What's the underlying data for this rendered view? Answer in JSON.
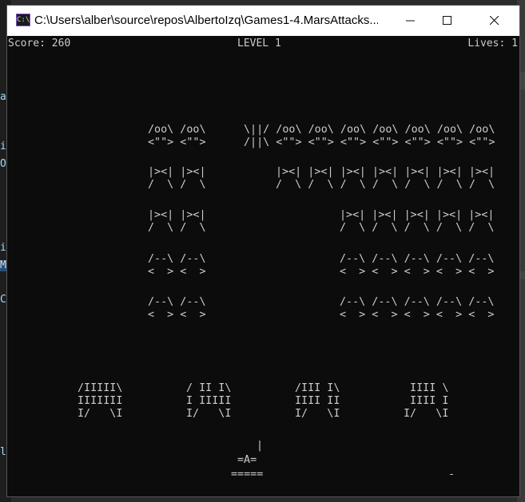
{
  "background_editor": {
    "fragments": [
      "a",
      "i",
      "O",
      "i",
      "M",
      "C",
      "l"
    ]
  },
  "window": {
    "icon_text": "C:\\",
    "title": "C:\\Users\\alber\\source\\repos\\AlbertoIzq\\Games1-4.MarsAttacks...",
    "buttons": {
      "minimize": "minimize",
      "maximize": "maximize",
      "close": "close"
    }
  },
  "hud": {
    "score": "Score: 260",
    "level": "LEVEL 1",
    "lives": "Lives: 1"
  },
  "aliens": {
    "row1_left": "/oo\\ /oo\\\n<\"\"> <\"\">",
    "row1_right": "\\||/ /oo\\ /oo\\ /oo\\ /oo\\ /oo\\ /oo\\ /oo\\\n/||\\ <\"\"> <\"\"> <\"\"> <\"\"> <\"\"> <\"\"> <\"\">",
    "row2_left": "|><| |><|\n/  \\ /  \\",
    "row2_right": "|><| |><| |><| |><| |><| |><| |><|\n/  \\ /  \\ /  \\ /  \\ /  \\ /  \\ /  \\",
    "row3_left": "|><| |><|\n/  \\ /  \\",
    "row3_right": "|><| |><| |><| |><| |><|\n/  \\ /  \\ /  \\ /  \\ /  \\",
    "row4_left": "/--\\ /--\\\n<  > <  >",
    "row4_right": "/--\\ /--\\ /--\\ /--\\ /--\\\n<  > <  > <  > <  > <  >",
    "row5_left": "/--\\ /--\\\n<  > <  >",
    "row5_right": "/--\\ /--\\ /--\\ /--\\ /--\\\n<  > <  > <  > <  > <  >"
  },
  "shields": [
    "/IIIII\\\nIIIIIII\nI/   \\I",
    "/ II I\\\nI IIIII\nI/   \\I",
    "/III I\\\nIIII II\nI/   \\I",
    " IIII \\\n IIII I\nI/   \\I"
  ],
  "player": {
    "bullet": "|",
    "ship": "=A=",
    "base": "====="
  },
  "alien_bullet": "-"
}
